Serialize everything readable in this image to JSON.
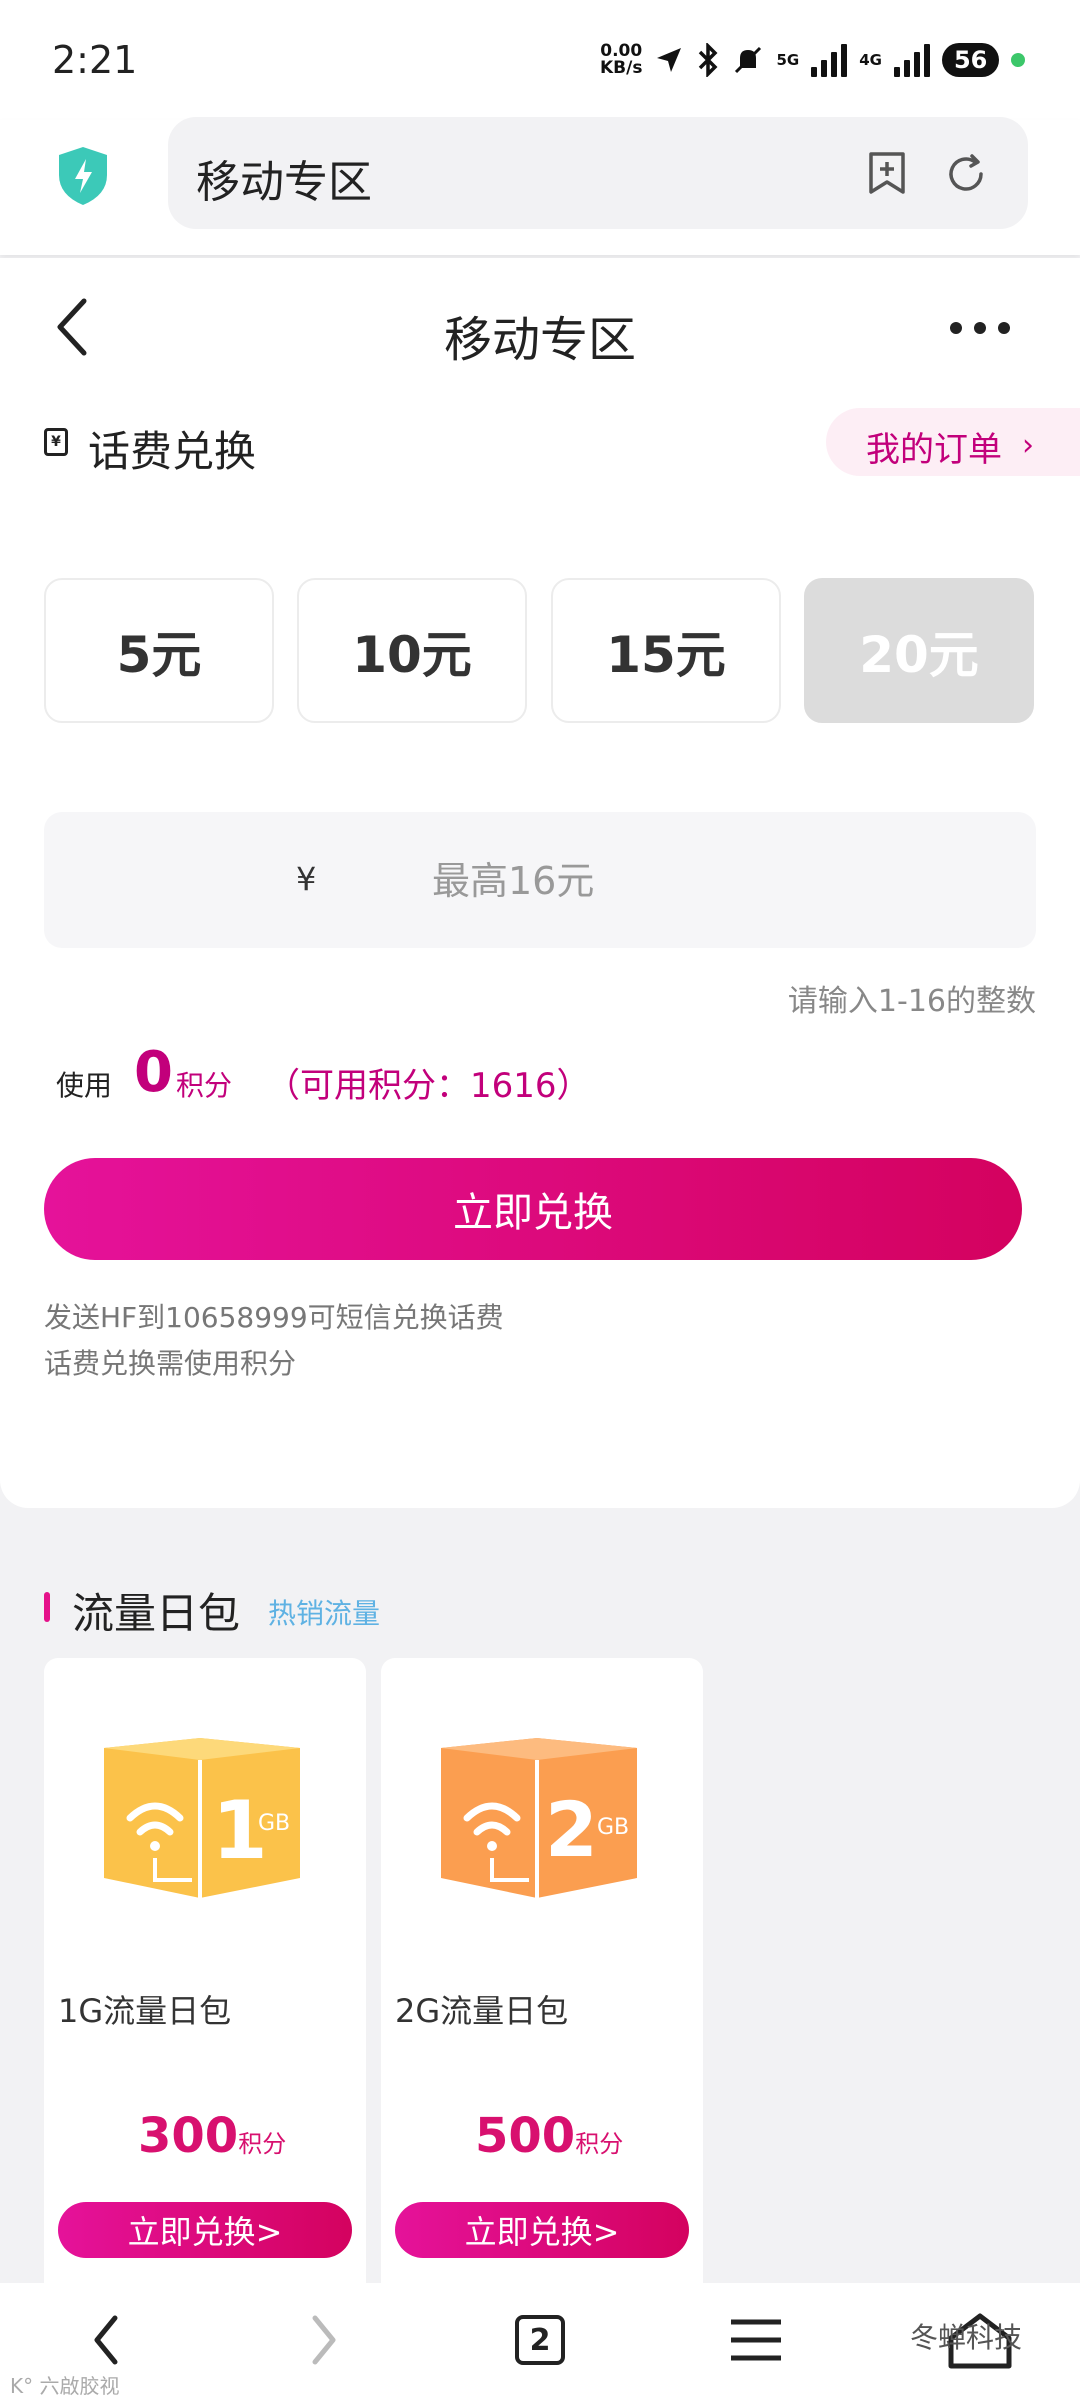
{
  "status_bar": {
    "time": "2:21",
    "net_speed_value": "0.00",
    "net_speed_unit": "KB/s",
    "sim1_type": "5G",
    "sim2_type": "4G",
    "battery": "56"
  },
  "browser": {
    "url_text": "移动专区"
  },
  "page": {
    "title": "移动专区"
  },
  "bill_exchange": {
    "section_title": "话费兑换",
    "bill_icon_glyph": "¥",
    "my_orders_label": "我的订单",
    "amounts": [
      "5元",
      "10元",
      "15元",
      "20元"
    ],
    "selected_index": 3,
    "currency_symbol": "¥",
    "amount_placeholder": "最高16元",
    "input_hint": "请输入1-16的整数",
    "use_label": "使用",
    "use_points_value": "0",
    "use_points_unit": "积分",
    "available_points": "（可用积分：1616）",
    "exchange_button": "立即兑换",
    "note_line1": "发送HF到10658999可短信兑换话费",
    "note_line2": "话费兑换需使用积分"
  },
  "data_packs": {
    "section_title": "流量日包",
    "tag": "热销流量",
    "items": [
      {
        "name": "1G流量日包",
        "icon_label": "1",
        "icon_unit": "GB",
        "price": "300",
        "price_unit": "积分",
        "button": "立即兑换>",
        "color": "#fbc24a"
      },
      {
        "name": "2G流量日包",
        "icon_label": "2",
        "icon_unit": "GB",
        "price": "500",
        "price_unit": "积分",
        "button": "立即兑换>",
        "color": "#fb9e50"
      }
    ]
  },
  "bottom_nav": {
    "tab_count": "2",
    "watermark": "冬蝉科技",
    "watermark_left": "K° 六啟胶视"
  },
  "colors": {
    "accent": "#d8106f",
    "accent_gradient_start": "#e5129a",
    "tag_blue": "#5fb2e3"
  }
}
